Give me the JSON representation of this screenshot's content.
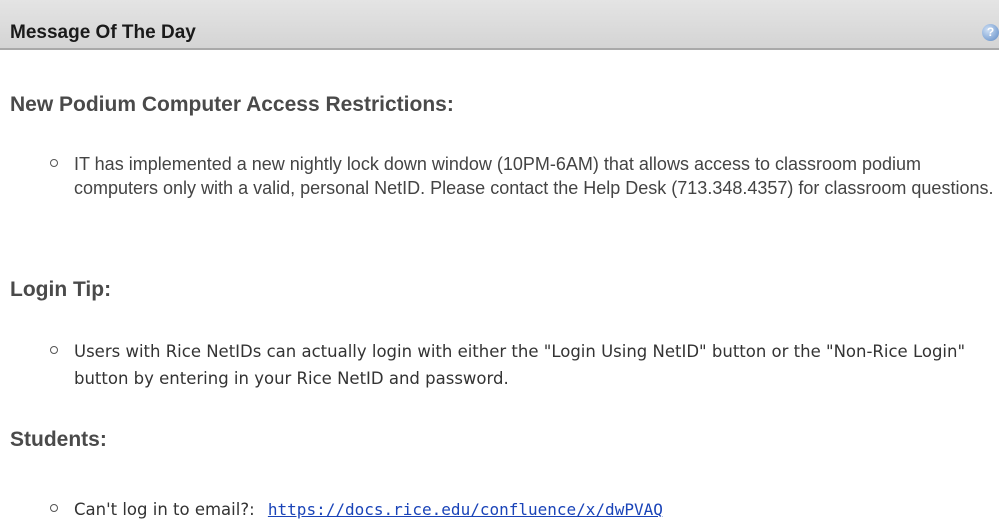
{
  "header": {
    "title": "Message Of The Day",
    "help_icon": "help-icon"
  },
  "sections": [
    {
      "heading": "New Podium Computer Access Restrictions:",
      "items": [
        "IT has implemented a new nightly lock down window (10PM-6AM) that allows access to classroom podium computers only with a valid, personal NetID. Please contact the Help Desk (713.348.4357) for classroom questions."
      ]
    },
    {
      "heading": "Login Tip:",
      "items": [
        "Users with Rice NetIDs can actually login with either the \"Login Using NetID\" button or the \"Non-Rice Login\" button by entering in your Rice NetID and password."
      ]
    },
    {
      "heading": "Students:",
      "items": [
        {
          "text": "Can't log in to email?:",
          "link": "https://docs.rice.edu/confluence/x/dwPVAQ"
        }
      ]
    }
  ]
}
